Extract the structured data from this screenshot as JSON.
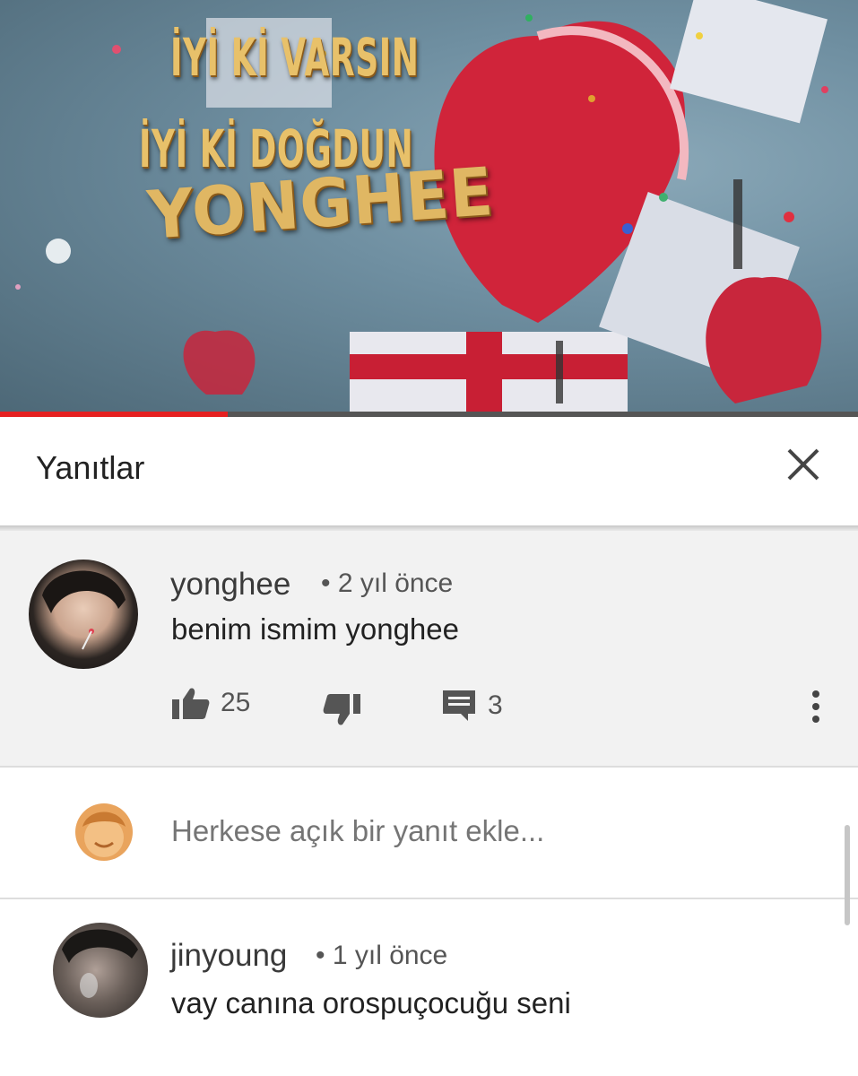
{
  "video": {
    "title_line1": "İYİ Kİ VARSIN",
    "title_line2": "İYİ Kİ DOĞDUN",
    "title_line3": "YONGHEE",
    "progress": 0.265
  },
  "panel": {
    "title": "Yanıtlar",
    "close_icon": "close-icon"
  },
  "main_comment": {
    "author": "yonghee",
    "time": "• 2 yıl önce",
    "text": "benim ismim yonghee",
    "likes": "25",
    "replies": "3"
  },
  "reply_box": {
    "placeholder": "Herkese açık bir yanıt ekle..."
  },
  "reply": {
    "author": "jinyoung",
    "time": "• 1 yıl önce",
    "text": "vay canına orospuçocuğu seni"
  },
  "colors": {
    "progress": "#e52020",
    "accent_gold": "#e8c16a"
  }
}
